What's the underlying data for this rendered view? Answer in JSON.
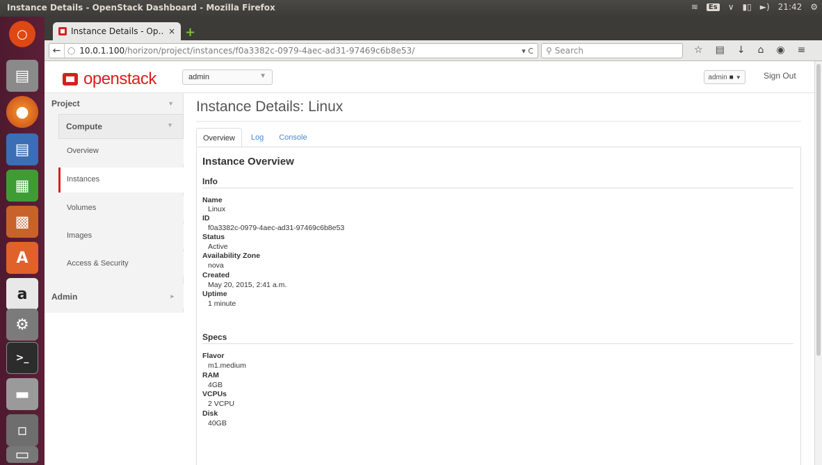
{
  "window": {
    "title": "Instance Details - OpenStack Dashboard - Mozilla Firefox"
  },
  "system": {
    "keyboard": "Es",
    "time": "21:42"
  },
  "browser": {
    "tab_title": "Instance Details - Op…",
    "tab_close": "×",
    "new_tab": "+",
    "url_host": "10.0.1.100",
    "url_path": "/horizon/project/instances/f0a3382c-0979-4aec-ad31-97469c6b8e53/",
    "search_placeholder": "Search"
  },
  "header": {
    "logo_text": "openstack",
    "project_select": "admin",
    "user_menu": "admin",
    "sign_out": "Sign Out"
  },
  "sidebar": {
    "project": "Project",
    "compute": "Compute",
    "items": [
      "Overview",
      "Instances",
      "Volumes",
      "Images",
      "Access & Security"
    ],
    "active": "Instances",
    "admin": "Admin"
  },
  "main": {
    "title": "Instance Details: Linux",
    "tabs": [
      "Overview",
      "Log",
      "Console"
    ],
    "active_tab": "Overview",
    "overview_title": "Instance Overview",
    "info_title": "Info",
    "info": [
      {
        "label": "Name",
        "value": "Linux"
      },
      {
        "label": "ID",
        "value": "f0a3382c-0979-4aec-ad31-97469c6b8e53"
      },
      {
        "label": "Status",
        "value": "Active"
      },
      {
        "label": "Availability Zone",
        "value": "nova"
      },
      {
        "label": "Created",
        "value": "May 20, 2015, 2:41 a.m."
      },
      {
        "label": "Uptime",
        "value": "1 minute"
      }
    ],
    "specs_title": "Specs",
    "specs": [
      {
        "label": "Flavor",
        "value": "m1.medium"
      },
      {
        "label": "RAM",
        "value": "4GB"
      },
      {
        "label": "VCPUs",
        "value": "2 VCPU"
      },
      {
        "label": "Disk",
        "value": "40GB"
      }
    ]
  },
  "colors": {
    "accent": "#d4211e",
    "link": "#4a88c6",
    "launcher": "#5c1f37"
  }
}
